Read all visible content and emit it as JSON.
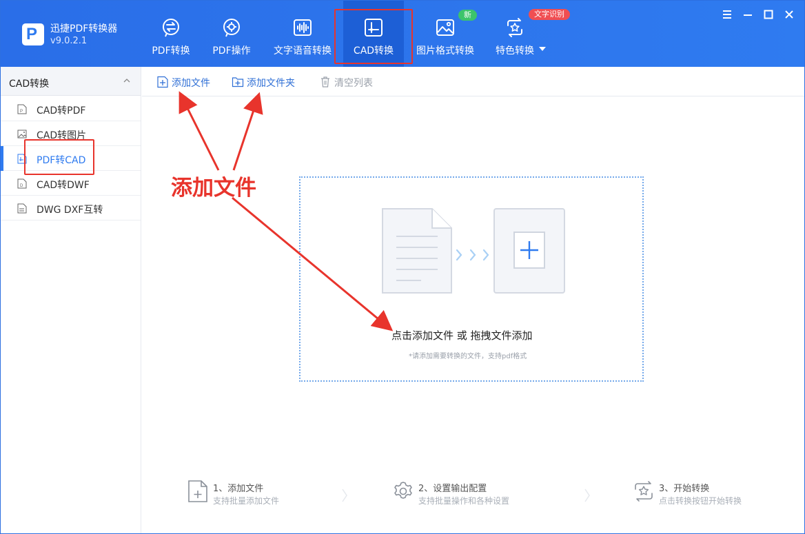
{
  "app": {
    "title": "迅捷PDF转换器",
    "version": "v9.0.2.1"
  },
  "tabs": [
    {
      "label": "PDF转换",
      "icon": "pdf-convert-icon"
    },
    {
      "label": "PDF操作",
      "icon": "pdf-operate-icon"
    },
    {
      "label": "文字语音转换",
      "icon": "voice-wave-icon"
    },
    {
      "label": "CAD转换",
      "icon": "cad-icon",
      "active": true
    },
    {
      "label": "图片格式转换",
      "icon": "image-icon"
    },
    {
      "label": "特色转换",
      "icon": "special-convert-icon"
    }
  ],
  "badges": {
    "new": "新",
    "ocr": "文字识别"
  },
  "sidebar": {
    "header": "CAD转换",
    "items": [
      {
        "label": "CAD转PDF",
        "icon": "file-p-icon"
      },
      {
        "label": "CAD转图片",
        "icon": "file-image-icon"
      },
      {
        "label": "PDF转CAD",
        "icon": "file-cad-icon",
        "active": true
      },
      {
        "label": "CAD转DWF",
        "icon": "file-d-icon"
      },
      {
        "label": "DWG DXF互转",
        "icon": "file-swap-icon"
      }
    ]
  },
  "toolbar": {
    "add_file": "添加文件",
    "add_folder": "添加文件夹",
    "clear_list": "清空列表"
  },
  "dropzone": {
    "main": "点击添加文件 或 拖拽文件添加",
    "sub": "*请添加需要转换的文件，支持pdf格式"
  },
  "steps": [
    {
      "title": "1、添加文件",
      "desc": "支持批量添加文件"
    },
    {
      "title": "2、设置输出配置",
      "desc": "支持批量操作和各种设置"
    },
    {
      "title": "3、开始转换",
      "desc": "点击转换按钮开始转换"
    }
  ],
  "annotation": {
    "text": "添加文件"
  },
  "colors": {
    "accent": "#2f7bf0",
    "header": "#2a6ee8",
    "highlight": "#e8342c"
  }
}
